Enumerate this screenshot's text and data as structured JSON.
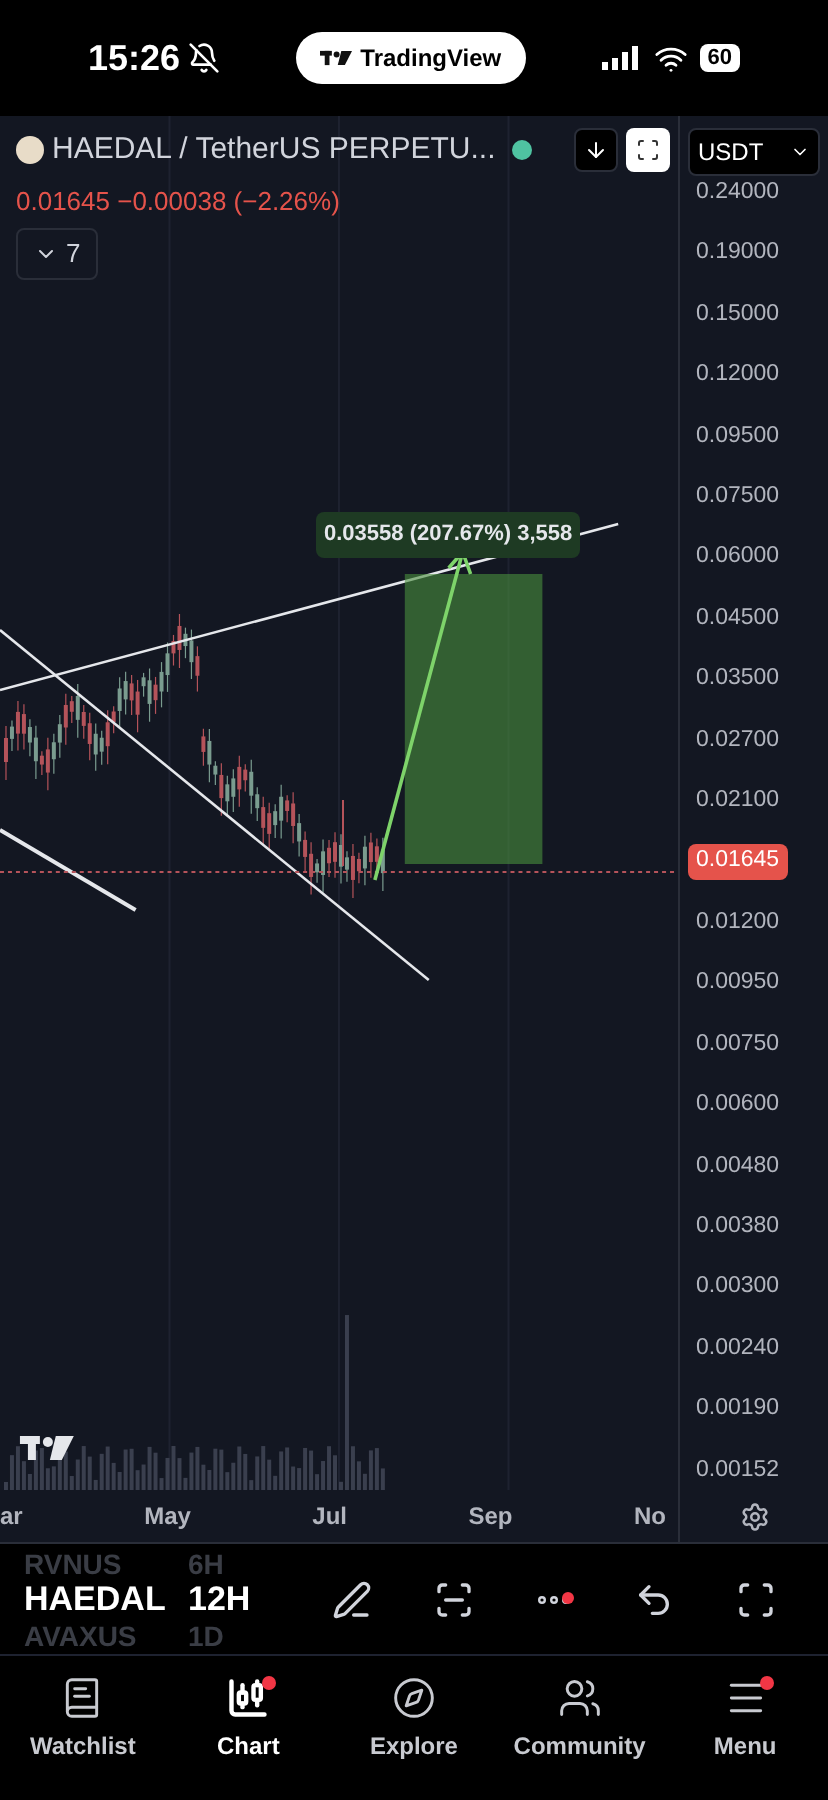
{
  "status_bar": {
    "time": "15:26",
    "app_pill": "TradingView",
    "battery": "60"
  },
  "header": {
    "symbol": "HAEDAL / TetherUS PERPETU...",
    "market_open": true,
    "price_line": "0.01645 −0.00038 (−2.26%)",
    "indicators_count": "7",
    "currency": "USDT"
  },
  "measure_label": "0.03558 (207.67%) 3,558",
  "price_axis": [
    {
      "label": "0.24000",
      "current": false
    },
    {
      "label": "0.19000",
      "current": false
    },
    {
      "label": "0.15000",
      "current": false
    },
    {
      "label": "0.12000",
      "current": false
    },
    {
      "label": "0.09500",
      "current": false
    },
    {
      "label": "0.07500",
      "current": false
    },
    {
      "label": "0.06000",
      "current": false
    },
    {
      "label": "0.04500",
      "current": false
    },
    {
      "label": "0.03500",
      "current": false
    },
    {
      "label": "0.02700",
      "current": false
    },
    {
      "label": "0.02100",
      "current": false
    },
    {
      "label": "0.01645",
      "current": true
    },
    {
      "label": "0.01200",
      "current": false
    },
    {
      "label": "0.00950",
      "current": false
    },
    {
      "label": "0.00750",
      "current": false
    },
    {
      "label": "0.00600",
      "current": false
    },
    {
      "label": "0.00480",
      "current": false
    },
    {
      "label": "0.00380",
      "current": false
    },
    {
      "label": "0.00300",
      "current": false
    },
    {
      "label": "0.00240",
      "current": false
    },
    {
      "label": "0.00190",
      "current": false
    },
    {
      "label": "0.00152",
      "current": false
    }
  ],
  "time_axis": [
    "ar",
    "May",
    "Jul",
    "Sep",
    "No"
  ],
  "symbol_picker": [
    {
      "symbol": "RVNUS",
      "interval": "6H",
      "selected": false
    },
    {
      "symbol": "HAEDAL",
      "interval": "12H",
      "selected": true
    },
    {
      "symbol": "AVAXUS",
      "interval": "1D",
      "selected": false
    }
  ],
  "toolbar": [
    {
      "kind": "pen",
      "badge": false
    },
    {
      "kind": "lines",
      "badge": false
    },
    {
      "kind": "more",
      "badge": true
    },
    {
      "kind": "undo",
      "badge": false
    },
    {
      "kind": "fullscreen",
      "badge": false
    }
  ],
  "nav": [
    {
      "kind": "watchlist",
      "label": "Watchlist",
      "selected": false,
      "badge": false
    },
    {
      "kind": "chart",
      "label": "Chart",
      "selected": true,
      "badge": true
    },
    {
      "kind": "explore",
      "label": "Explore",
      "selected": false,
      "badge": false
    },
    {
      "kind": "community",
      "label": "Community",
      "selected": false,
      "badge": false
    },
    {
      "kind": "menu",
      "label": "Menu",
      "selected": false,
      "badge": true
    }
  ]
}
